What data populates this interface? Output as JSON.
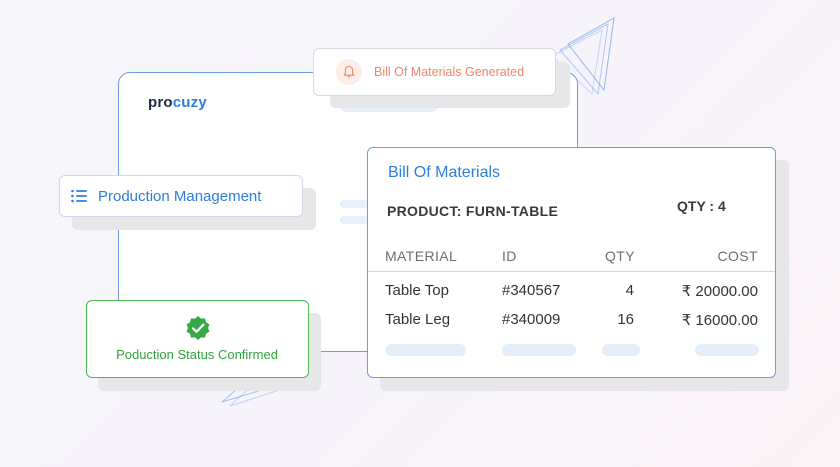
{
  "app": {
    "logo_prefix": "pro",
    "logo_accent": "cuzy"
  },
  "notification": {
    "text": "Bill Of Materials Generated",
    "icon": "bell-icon"
  },
  "production": {
    "label": "Production Management",
    "icon": "list-icon"
  },
  "bom": {
    "title": "Bill Of Materials",
    "product": "PRODUCT: FURN-TABLE",
    "qty": "QTY : 4",
    "columns": [
      "MATERIAL",
      "ID",
      "QTY",
      "COST"
    ],
    "rows": [
      {
        "material": "Table Top",
        "id": "#340567",
        "qty": "4",
        "cost": "₹ 20000.00"
      },
      {
        "material": "Table Leg",
        "id": "#340009",
        "qty": "16",
        "cost": "₹ 16000.00"
      }
    ]
  },
  "status": {
    "text": "Poduction Status Confirmed",
    "icon": "check-badge-icon"
  },
  "colors": {
    "accent_blue": "#2f7de1",
    "success_green": "#2ea43a",
    "notify_orange": "#f0856a"
  }
}
